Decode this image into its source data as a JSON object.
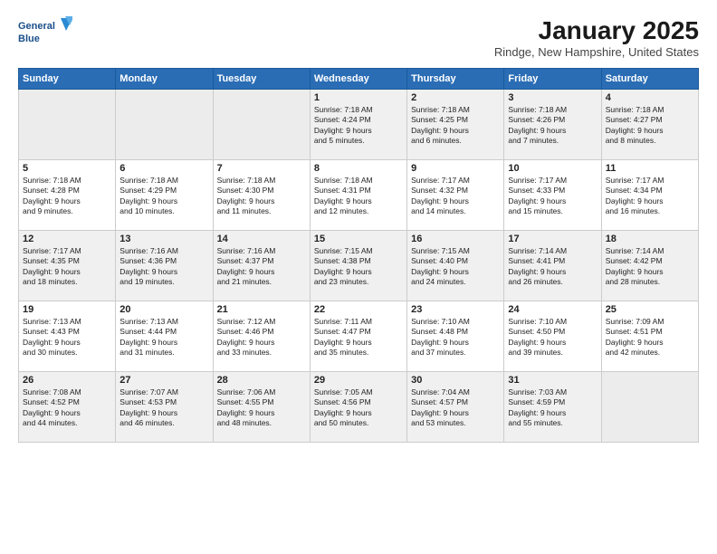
{
  "header": {
    "logo_line1": "General",
    "logo_line2": "Blue",
    "month": "January 2025",
    "location": "Rindge, New Hampshire, United States"
  },
  "weekdays": [
    "Sunday",
    "Monday",
    "Tuesday",
    "Wednesday",
    "Thursday",
    "Friday",
    "Saturday"
  ],
  "weeks": [
    [
      {
        "day": "",
        "info": ""
      },
      {
        "day": "",
        "info": ""
      },
      {
        "day": "",
        "info": ""
      },
      {
        "day": "1",
        "info": "Sunrise: 7:18 AM\nSunset: 4:24 PM\nDaylight: 9 hours\nand 5 minutes."
      },
      {
        "day": "2",
        "info": "Sunrise: 7:18 AM\nSunset: 4:25 PM\nDaylight: 9 hours\nand 6 minutes."
      },
      {
        "day": "3",
        "info": "Sunrise: 7:18 AM\nSunset: 4:26 PM\nDaylight: 9 hours\nand 7 minutes."
      },
      {
        "day": "4",
        "info": "Sunrise: 7:18 AM\nSunset: 4:27 PM\nDaylight: 9 hours\nand 8 minutes."
      }
    ],
    [
      {
        "day": "5",
        "info": "Sunrise: 7:18 AM\nSunset: 4:28 PM\nDaylight: 9 hours\nand 9 minutes."
      },
      {
        "day": "6",
        "info": "Sunrise: 7:18 AM\nSunset: 4:29 PM\nDaylight: 9 hours\nand 10 minutes."
      },
      {
        "day": "7",
        "info": "Sunrise: 7:18 AM\nSunset: 4:30 PM\nDaylight: 9 hours\nand 11 minutes."
      },
      {
        "day": "8",
        "info": "Sunrise: 7:18 AM\nSunset: 4:31 PM\nDaylight: 9 hours\nand 12 minutes."
      },
      {
        "day": "9",
        "info": "Sunrise: 7:17 AM\nSunset: 4:32 PM\nDaylight: 9 hours\nand 14 minutes."
      },
      {
        "day": "10",
        "info": "Sunrise: 7:17 AM\nSunset: 4:33 PM\nDaylight: 9 hours\nand 15 minutes."
      },
      {
        "day": "11",
        "info": "Sunrise: 7:17 AM\nSunset: 4:34 PM\nDaylight: 9 hours\nand 16 minutes."
      }
    ],
    [
      {
        "day": "12",
        "info": "Sunrise: 7:17 AM\nSunset: 4:35 PM\nDaylight: 9 hours\nand 18 minutes."
      },
      {
        "day": "13",
        "info": "Sunrise: 7:16 AM\nSunset: 4:36 PM\nDaylight: 9 hours\nand 19 minutes."
      },
      {
        "day": "14",
        "info": "Sunrise: 7:16 AM\nSunset: 4:37 PM\nDaylight: 9 hours\nand 21 minutes."
      },
      {
        "day": "15",
        "info": "Sunrise: 7:15 AM\nSunset: 4:38 PM\nDaylight: 9 hours\nand 23 minutes."
      },
      {
        "day": "16",
        "info": "Sunrise: 7:15 AM\nSunset: 4:40 PM\nDaylight: 9 hours\nand 24 minutes."
      },
      {
        "day": "17",
        "info": "Sunrise: 7:14 AM\nSunset: 4:41 PM\nDaylight: 9 hours\nand 26 minutes."
      },
      {
        "day": "18",
        "info": "Sunrise: 7:14 AM\nSunset: 4:42 PM\nDaylight: 9 hours\nand 28 minutes."
      }
    ],
    [
      {
        "day": "19",
        "info": "Sunrise: 7:13 AM\nSunset: 4:43 PM\nDaylight: 9 hours\nand 30 minutes."
      },
      {
        "day": "20",
        "info": "Sunrise: 7:13 AM\nSunset: 4:44 PM\nDaylight: 9 hours\nand 31 minutes."
      },
      {
        "day": "21",
        "info": "Sunrise: 7:12 AM\nSunset: 4:46 PM\nDaylight: 9 hours\nand 33 minutes."
      },
      {
        "day": "22",
        "info": "Sunrise: 7:11 AM\nSunset: 4:47 PM\nDaylight: 9 hours\nand 35 minutes."
      },
      {
        "day": "23",
        "info": "Sunrise: 7:10 AM\nSunset: 4:48 PM\nDaylight: 9 hours\nand 37 minutes."
      },
      {
        "day": "24",
        "info": "Sunrise: 7:10 AM\nSunset: 4:50 PM\nDaylight: 9 hours\nand 39 minutes."
      },
      {
        "day": "25",
        "info": "Sunrise: 7:09 AM\nSunset: 4:51 PM\nDaylight: 9 hours\nand 42 minutes."
      }
    ],
    [
      {
        "day": "26",
        "info": "Sunrise: 7:08 AM\nSunset: 4:52 PM\nDaylight: 9 hours\nand 44 minutes."
      },
      {
        "day": "27",
        "info": "Sunrise: 7:07 AM\nSunset: 4:53 PM\nDaylight: 9 hours\nand 46 minutes."
      },
      {
        "day": "28",
        "info": "Sunrise: 7:06 AM\nSunset: 4:55 PM\nDaylight: 9 hours\nand 48 minutes."
      },
      {
        "day": "29",
        "info": "Sunrise: 7:05 AM\nSunset: 4:56 PM\nDaylight: 9 hours\nand 50 minutes."
      },
      {
        "day": "30",
        "info": "Sunrise: 7:04 AM\nSunset: 4:57 PM\nDaylight: 9 hours\nand 53 minutes."
      },
      {
        "day": "31",
        "info": "Sunrise: 7:03 AM\nSunset: 4:59 PM\nDaylight: 9 hours\nand 55 minutes."
      },
      {
        "day": "",
        "info": ""
      }
    ]
  ]
}
